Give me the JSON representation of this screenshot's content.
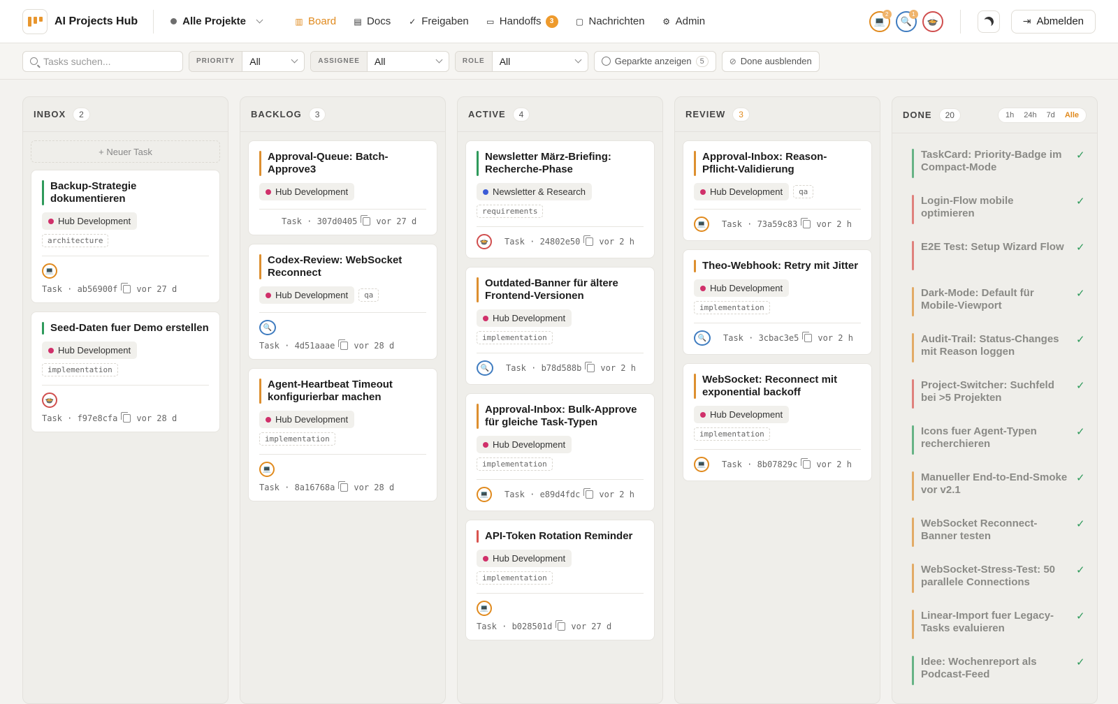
{
  "app": {
    "title": "AI Projects Hub"
  },
  "project_select": {
    "label": "Alle Projekte"
  },
  "nav": [
    {
      "id": "board",
      "label": "Board",
      "icon": "board-icon",
      "active": true
    },
    {
      "id": "docs",
      "label": "Docs",
      "icon": "doc-icon"
    },
    {
      "id": "freigaben",
      "label": "Freigaben",
      "icon": "double-check-icon"
    },
    {
      "id": "handoffs",
      "label": "Handoffs",
      "icon": "inbox-icon",
      "badge": "3"
    },
    {
      "id": "nachrichten",
      "label": "Nachrichten",
      "icon": "chat-icon"
    },
    {
      "id": "admin",
      "label": "Admin",
      "icon": "gear-icon"
    }
  ],
  "agents": [
    {
      "icon": "laptop-icon",
      "badge": "2",
      "color": "#e08a1e"
    },
    {
      "icon": "search-icon",
      "badge": "1",
      "color": "#3f7cc0"
    },
    {
      "icon": "bowl-icon",
      "badge": "",
      "color": "#d04e4e"
    }
  ],
  "logout": {
    "label": "Abmelden"
  },
  "filters": {
    "search_placeholder": "Tasks suchen...",
    "priority": {
      "label": "PRIORITY",
      "value": "All"
    },
    "assignee": {
      "label": "ASSIGNEE",
      "value": "All"
    },
    "role": {
      "label": "ROLE",
      "value": "All"
    },
    "parked": {
      "label": "Geparkte anzeigen",
      "count": "5"
    },
    "hide_done": {
      "label": "Done ausblenden"
    }
  },
  "colors": {
    "accent": "#e08a1e",
    "hub": "#d0306a",
    "news": "#3b5bd6",
    "green": "#2e9a5b",
    "amber": "#dd8f2f",
    "red": "#d9534f"
  },
  "columns": [
    {
      "title": "INBOX",
      "count": "2",
      "new_task": "+ Neuer Task",
      "cards": [
        {
          "title": "Backup-Strategie dokumentieren",
          "prio": "green",
          "project": "Hub Development",
          "projColor": "hub",
          "tags": [
            "architecture"
          ],
          "avatar": "laptop",
          "avatarRow": true,
          "meta": "Task · ab56900f",
          "age": "vor 27 d"
        },
        {
          "title": "Seed-Daten fuer Demo erstellen",
          "prio": "green",
          "project": "Hub Development",
          "projColor": "hub",
          "tags": [
            "implementation"
          ],
          "avatar": "bowl",
          "avatarRow": true,
          "meta": "Task · f97e8cfa",
          "age": "vor 28 d"
        }
      ]
    },
    {
      "title": "BACKLOG",
      "count": "3",
      "cards": [
        {
          "title": "Approval-Queue: Batch-Approve3",
          "prio": "amber",
          "project": "Hub Development",
          "projColor": "hub",
          "tags": [],
          "avatar": "",
          "meta": "Task · 307d0405",
          "age": "vor 27 d"
        },
        {
          "title": "Codex-Review: WebSocket Reconnect",
          "prio": "amber",
          "project": "Hub Development",
          "projColor": "hub",
          "inlineTag": "qa",
          "tags": [],
          "avatar": "search",
          "avatarRow": true,
          "meta": "Task · 4d51aaae",
          "age": "vor 28 d"
        },
        {
          "title": "Agent-Heartbeat Timeout konfigurierbar machen",
          "prio": "amber",
          "project": "Hub Development",
          "projColor": "hub",
          "tags": [
            "implementation"
          ],
          "avatar": "laptop",
          "avatarRow": true,
          "meta": "Task · 8a16768a",
          "age": "vor 28 d"
        }
      ]
    },
    {
      "title": "ACTIVE",
      "count": "4",
      "cards": [
        {
          "title": "Newsletter März-Briefing: Recherche-Phase",
          "prio": "green",
          "project": "Newsletter & Research",
          "projColor": "news",
          "tags": [
            "requirements"
          ],
          "avatar": "bowl",
          "meta": "Task · 24802e50",
          "age": "vor 2 h"
        },
        {
          "title": "Outdated-Banner für ältere Frontend-Versionen",
          "prio": "amber",
          "project": "Hub Development",
          "projColor": "hub",
          "tags": [
            "implementation"
          ],
          "avatar": "search",
          "meta": "Task · b78d588b",
          "age": "vor 2 h"
        },
        {
          "title": "Approval-Inbox: Bulk-Approve für gleiche Task-Typen",
          "prio": "amber",
          "project": "Hub Development",
          "projColor": "hub",
          "tags": [
            "implementation"
          ],
          "avatar": "laptop",
          "meta": "Task · e89d4fdc",
          "age": "vor 2 h"
        },
        {
          "title": "API-Token Rotation Reminder",
          "prio": "red",
          "project": "Hub Development",
          "projColor": "hub",
          "tags": [
            "implementation"
          ],
          "avatar": "laptop",
          "avatarRow": true,
          "meta": "Task · b028501d",
          "age": "vor 27 d"
        }
      ]
    },
    {
      "title": "REVIEW",
      "count": "3",
      "amber": true,
      "cards": [
        {
          "title": "Approval-Inbox: Reason-Pflicht-Validierung",
          "prio": "amber",
          "project": "Hub Development",
          "projColor": "hub",
          "inlineTag": "qa",
          "tags": [],
          "avatar": "laptop",
          "meta": "Task · 73a59c83",
          "age": "vor 2 h"
        },
        {
          "title": "Theo-Webhook: Retry mit Jitter",
          "prio": "amber",
          "project": "Hub Development",
          "projColor": "hub",
          "tags": [
            "implementation"
          ],
          "avatar": "search",
          "meta": "Task · 3cbac3e5",
          "age": "vor 2 h"
        },
        {
          "title": "WebSocket: Reconnect mit exponential backoff",
          "prio": "amber",
          "project": "Hub Development",
          "projColor": "hub",
          "tags": [
            "implementation"
          ],
          "avatar": "laptop",
          "meta": "Task · 8b07829c",
          "age": "vor 2 h"
        }
      ]
    }
  ],
  "done": {
    "title": "DONE",
    "count": "20",
    "time_filters": [
      "1h",
      "24h",
      "7d",
      "Alle"
    ],
    "time_selected": "Alle",
    "items": [
      {
        "title": "TaskCard: Priority-Badge im Compact-Mode",
        "prio": "green"
      },
      {
        "title": "Login-Flow mobile optimieren",
        "prio": "red"
      },
      {
        "title": "E2E Test: Setup Wizard Flow",
        "prio": "red"
      },
      {
        "title": "Dark-Mode: Default für Mobile-Viewport",
        "prio": "amber"
      },
      {
        "title": "Audit-Trail: Status-Changes mit Reason loggen",
        "prio": "amber"
      },
      {
        "title": "Project-Switcher: Suchfeld bei >5 Projekten",
        "prio": "red"
      },
      {
        "title": "Icons fuer Agent-Typen recherchieren",
        "prio": "green"
      },
      {
        "title": "Manueller End-to-End-Smoke vor v2.1",
        "prio": "amber"
      },
      {
        "title": "WebSocket Reconnect-Banner testen",
        "prio": "amber"
      },
      {
        "title": "WebSocket-Stress-Test: 50 parallele Connections",
        "prio": "amber"
      },
      {
        "title": "Linear-Import fuer Legacy-Tasks evaluieren",
        "prio": "amber"
      },
      {
        "title": "Idee: Wochenreport als Podcast-Feed",
        "prio": "green"
      }
    ]
  }
}
